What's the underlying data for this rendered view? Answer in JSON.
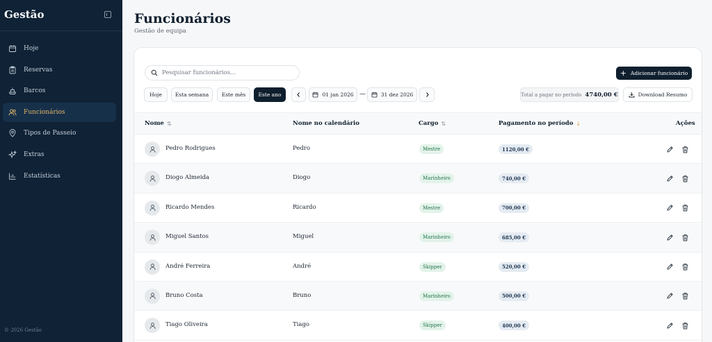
{
  "sidebar": {
    "brand": "Gestão",
    "items": [
      {
        "label": "Hoje",
        "icon": "calendar-icon",
        "active": false
      },
      {
        "label": "Reservas",
        "icon": "clipboard-icon",
        "active": false
      },
      {
        "label": "Barcos",
        "icon": "ship-icon",
        "active": false
      },
      {
        "label": "Funcionários",
        "icon": "users-icon",
        "active": true
      },
      {
        "label": "Tipos de Passeio",
        "icon": "map-pin-icon",
        "active": false
      },
      {
        "label": "Extras",
        "icon": "sparkles-icon",
        "active": false
      },
      {
        "label": "Estatísticas",
        "icon": "bar-chart-icon",
        "active": false
      }
    ],
    "footer": "© 2026 Gestão"
  },
  "header": {
    "title": "Funcionários",
    "subtitle": "Gestão de equipa"
  },
  "toolbar": {
    "search_placeholder": "Pesquisar funcionários...",
    "add_label": "Adicionar funcionário",
    "periods": [
      "Hoje",
      "Esta semana",
      "Este mês",
      "Este ano"
    ],
    "active_period": "Este ano",
    "date_from": "01 jan 2026",
    "date_sep": "—",
    "date_to": "31 dez 2026",
    "total_label": "Total a pagar no período",
    "total_amount": "4740,00 €",
    "download_label": "Download Resumo"
  },
  "table": {
    "columns": {
      "name": "Nome",
      "calendar_name": "Nome no calendário",
      "role": "Cargo",
      "payment": "Pagamento no período",
      "actions": "Ações"
    },
    "rows": [
      {
        "name": "Pedro Rodrigues",
        "calendar_name": "Pedro",
        "role": "Mestre",
        "payment": "1120,00 €"
      },
      {
        "name": "Diogo Almeida",
        "calendar_name": "Diogo",
        "role": "Marinheiro",
        "payment": "740,00 €"
      },
      {
        "name": "Ricardo Mendes",
        "calendar_name": "Ricardo",
        "role": "Mestre",
        "payment": "700,00 €"
      },
      {
        "name": "Miguel Santos",
        "calendar_name": "Miguel",
        "role": "Marinheiro",
        "payment": "685,00 €"
      },
      {
        "name": "André Ferreira",
        "calendar_name": "André",
        "role": "Skipper",
        "payment": "520,00 €"
      },
      {
        "name": "Bruno Costa",
        "calendar_name": "Bruno",
        "role": "Marinheiro",
        "payment": "500,00 €"
      },
      {
        "name": "Tiago Oliveira",
        "calendar_name": "Tiago",
        "role": "Skipper",
        "payment": "400,00 €"
      }
    ]
  },
  "colors": {
    "sidebar_bg": "#0f2236",
    "accent": "#e0b56a",
    "primary": "#0f1f2e",
    "badge_green_bg": "#e3f3ea",
    "badge_green_text": "#23744a",
    "badge_blue_bg": "#e5ebf2"
  }
}
